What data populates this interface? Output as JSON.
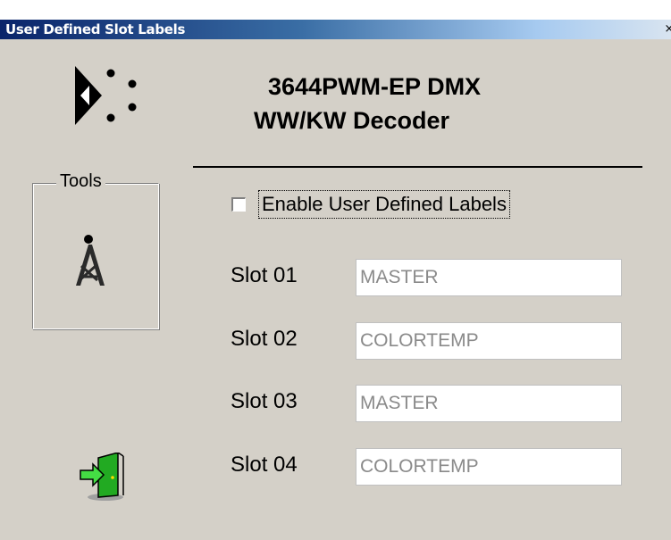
{
  "window": {
    "title": "User Defined Slot Labels",
    "close_glyph": "×"
  },
  "header": {
    "line1": "3644PWM-EP DMX",
    "line2": "WW/KW Decoder",
    "logo_icon": "company-logo-icon"
  },
  "tools": {
    "label": "Tools",
    "icon": "transmitter-tower-icon"
  },
  "enable": {
    "label": "Enable User Defined Labels",
    "checked": false
  },
  "slots": [
    {
      "label": "Slot 01",
      "value": "MASTER"
    },
    {
      "label": "Slot 02",
      "value": "COLORTEMP"
    },
    {
      "label": "Slot 03",
      "value": "MASTER"
    },
    {
      "label": "Slot 04",
      "value": "COLORTEMP"
    }
  ],
  "exit": {
    "icon": "exit-door-icon"
  },
  "colors": {
    "titlebar_start": "#0a246a",
    "titlebar_end": "#d8e4f0",
    "dialog_bg": "#d4d0c8",
    "field_text": "#8a8a8a",
    "exit_arrow": "#33cc33"
  }
}
